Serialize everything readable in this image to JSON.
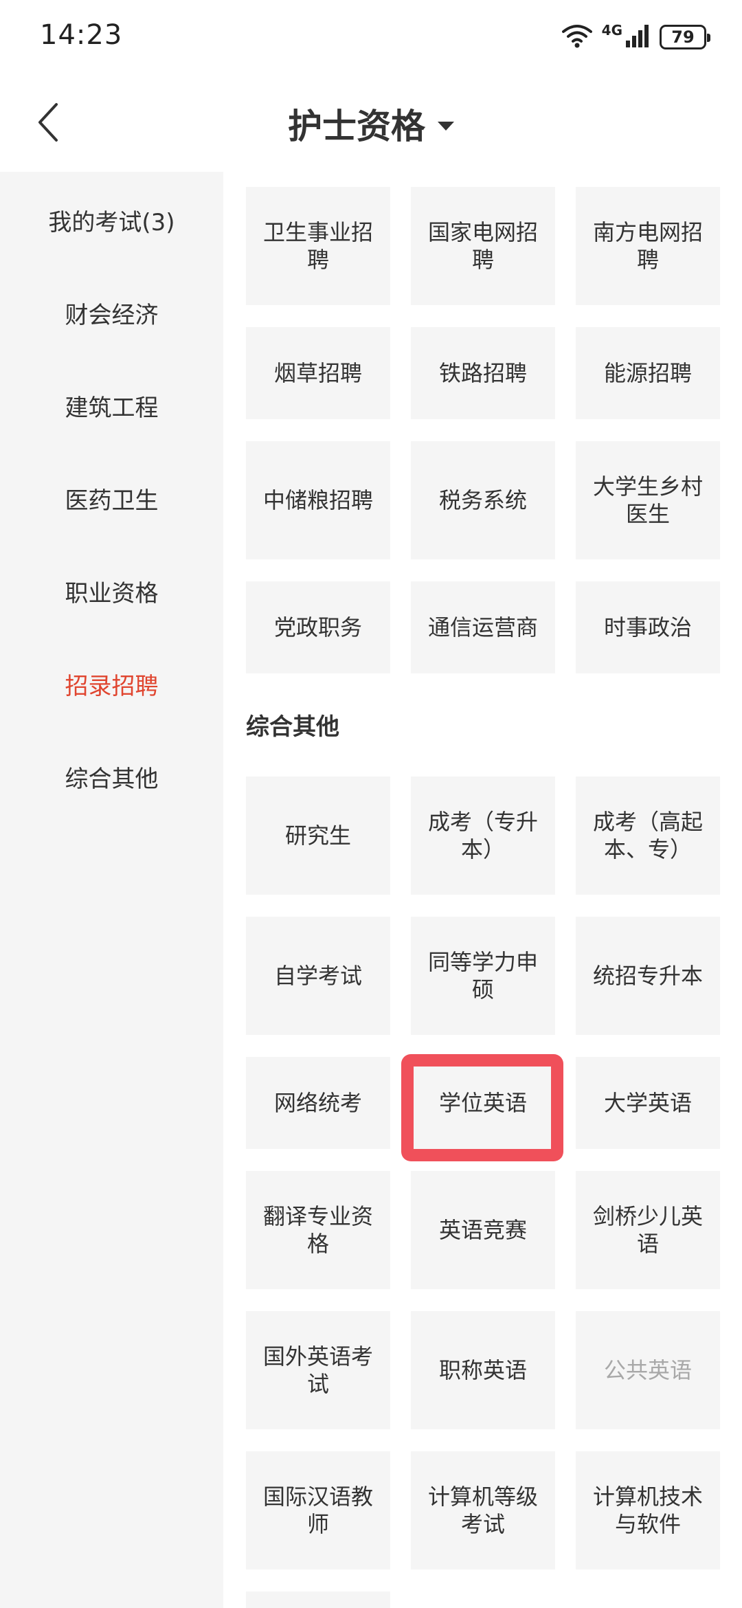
{
  "status_bar": {
    "time": "14:23",
    "network": "4G",
    "battery": "79"
  },
  "header": {
    "title": "护士资格"
  },
  "sidebar": {
    "items": [
      {
        "label": "我的考试(3)"
      },
      {
        "label": "财会经济"
      },
      {
        "label": "建筑工程"
      },
      {
        "label": "医药卫生"
      },
      {
        "label": "职业资格"
      },
      {
        "label": "招录招聘",
        "active": true
      },
      {
        "label": "综合其他"
      }
    ]
  },
  "recruitment": {
    "tiles": [
      "卫生事业招聘",
      "国家电网招聘",
      "南方电网招聘",
      "烟草招聘",
      "铁路招聘",
      "能源招聘",
      "中储粮招聘",
      "税务系统",
      "大学生乡村医生",
      "党政职务",
      "通信运营商",
      "时事政治"
    ]
  },
  "other": {
    "section_title": "综合其他",
    "tiles": [
      "研究生",
      "成考（专升本）",
      "成考（高起本、专）",
      "自学考试",
      "同等学力申硕",
      "统招专升本",
      "网络统考",
      "学位英语",
      "大学英语",
      "翻译专业资格",
      "英语竞赛",
      "剑桥少儿英语",
      "国外英语考试",
      "职称英语",
      "公共英语",
      "国际汉语教师",
      "计算机等级考试",
      "计算机技术与软件"
    ],
    "highlighted": "学位英语",
    "disabled": "公共英语"
  },
  "colors": {
    "accent": "#e0452f",
    "highlight_frame": "#f0505a",
    "tile_bg": "#f5f5f5",
    "sidebar_bg": "#f5f5f5"
  }
}
